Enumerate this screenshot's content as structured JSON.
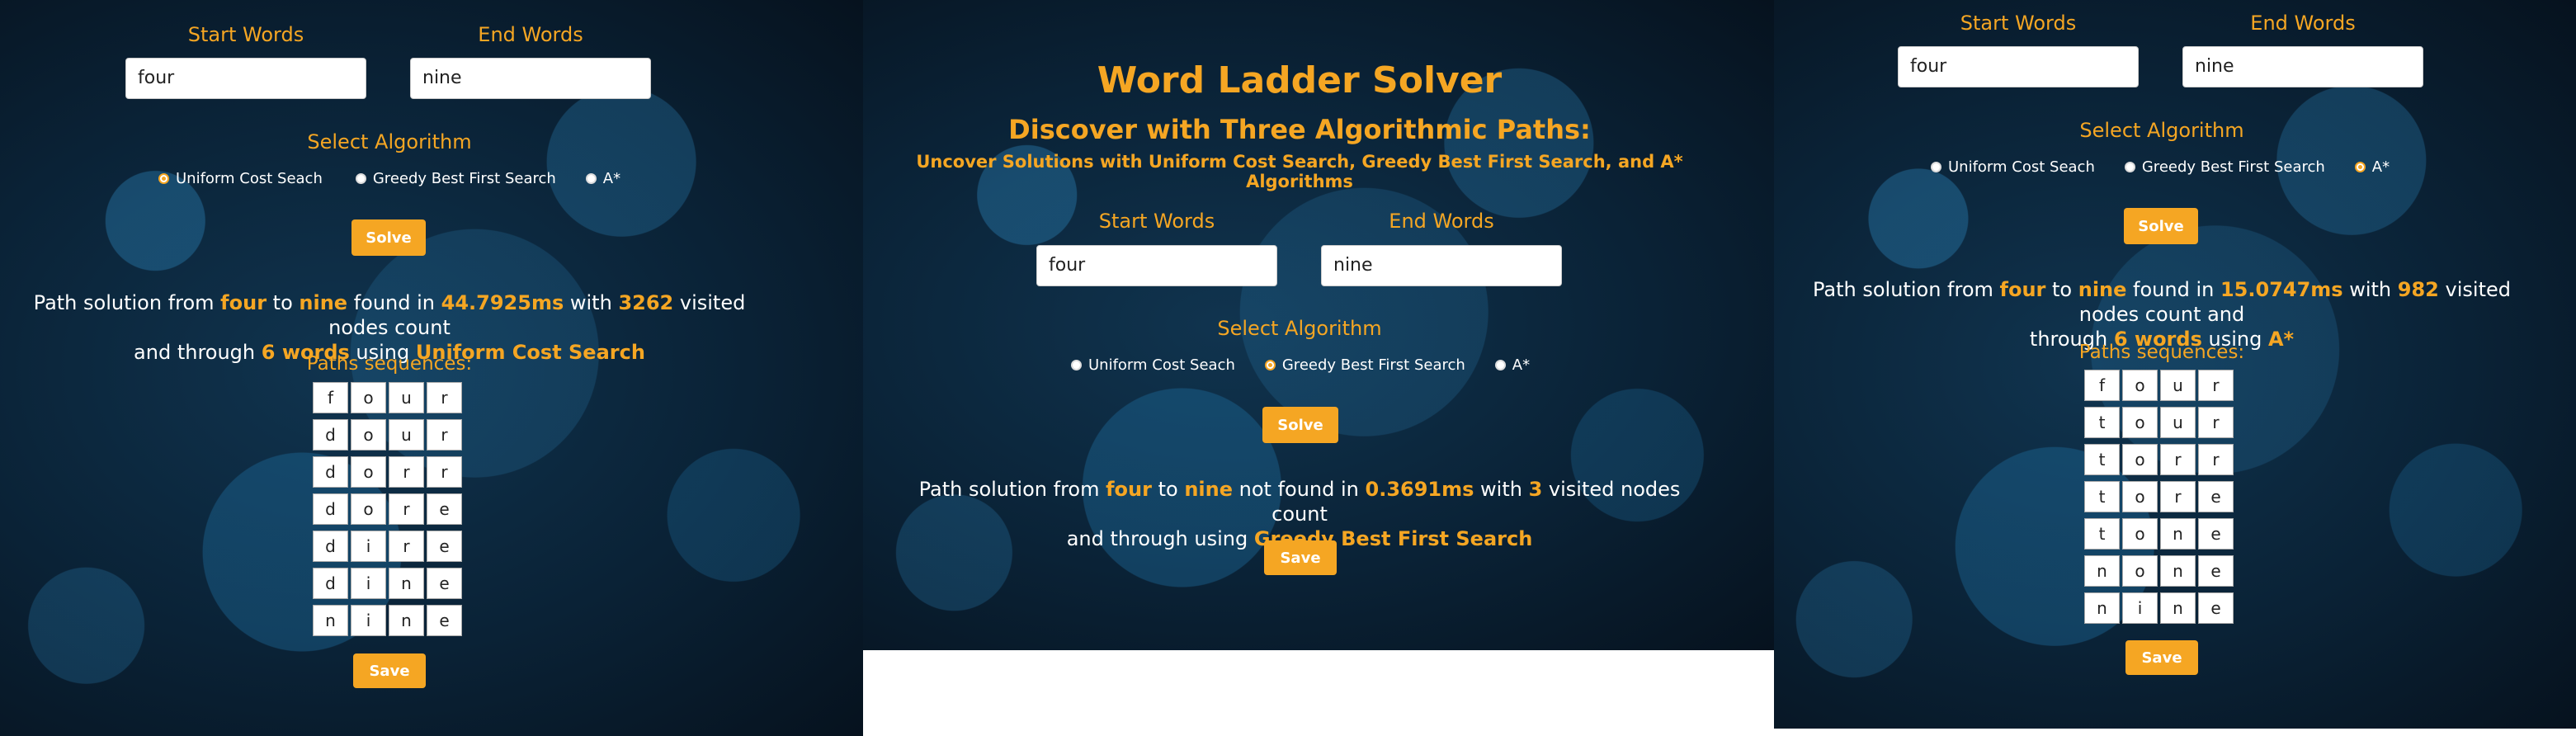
{
  "panel1": {
    "start_label": "Start Words",
    "end_label": "End Words",
    "start_value": "four",
    "end_value": "nine",
    "algo_label": "Select Algorithm",
    "options": [
      "Uniform Cost Seach",
      "Greedy Best First Search",
      "A*"
    ],
    "selected": 0,
    "solve_label": "Solve",
    "result": {
      "p1": "Path solution from ",
      "from": "four",
      "p2": " to ",
      "to": "nine",
      "p3": " found in ",
      "time": "44.7925ms",
      "p4": " with ",
      "visited": "3262",
      "p5": " visited nodes count",
      "p6": "and through ",
      "words": "6 words",
      "p7": " using ",
      "algo": "Uniform Cost Search"
    },
    "paths_title": "Paths sequences:",
    "paths": [
      [
        "f",
        "o",
        "u",
        "r"
      ],
      [
        "d",
        "o",
        "u",
        "r"
      ],
      [
        "d",
        "o",
        "r",
        "r"
      ],
      [
        "d",
        "o",
        "r",
        "e"
      ],
      [
        "d",
        "i",
        "r",
        "e"
      ],
      [
        "d",
        "i",
        "n",
        "e"
      ],
      [
        "n",
        "i",
        "n",
        "e"
      ]
    ],
    "save_label": "Save"
  },
  "panel2": {
    "title": "Word Ladder Solver",
    "subtitle": "Discover with Three Algorithmic Paths:",
    "subsubtitle": "Uncover Solutions with Uniform Cost Search, Greedy Best First Search, and A* Algorithms",
    "start_label": "Start Words",
    "end_label": "End Words",
    "start_value": "four",
    "end_value": "nine",
    "algo_label": "Select Algorithm",
    "options": [
      "Uniform Cost Seach",
      "Greedy Best First Search",
      "A*"
    ],
    "selected": 1,
    "solve_label": "Solve",
    "result": {
      "p1": "Path solution from ",
      "from": "four",
      "p2": " to ",
      "to": "nine",
      "p3": " not found in ",
      "time": "0.3691ms",
      "p4": " with ",
      "visited": "3",
      "p5": " visited nodes count",
      "p6": "and through using ",
      "algo": "Greedy Best First Search"
    },
    "save_label": "Save"
  },
  "panel3": {
    "start_label": "Start Words",
    "end_label": "End Words",
    "start_value": "four",
    "end_value": "nine",
    "algo_label": "Select Algorithm",
    "options": [
      "Uniform Cost Seach",
      "Greedy Best First Search",
      "A*"
    ],
    "selected": 2,
    "solve_label": "Solve",
    "result": {
      "p1": "Path solution from ",
      "from": "four",
      "p2": " to ",
      "to": "nine",
      "p3": " found in ",
      "time": "15.0747ms",
      "p4": " with ",
      "visited": "982",
      "p5": " visited nodes count and",
      "p6": "through ",
      "words": "6 words",
      "p7": " using ",
      "algo": "A*"
    },
    "paths_title": "Paths sequences:",
    "paths": [
      [
        "f",
        "o",
        "u",
        "r"
      ],
      [
        "t",
        "o",
        "u",
        "r"
      ],
      [
        "t",
        "o",
        "r",
        "r"
      ],
      [
        "t",
        "o",
        "r",
        "e"
      ],
      [
        "t",
        "o",
        "n",
        "e"
      ],
      [
        "n",
        "o",
        "n",
        "e"
      ],
      [
        "n",
        "i",
        "n",
        "e"
      ]
    ],
    "save_label": "Save"
  },
  "colors": {
    "accent": "#f5a623",
    "background": "#0a2236"
  }
}
